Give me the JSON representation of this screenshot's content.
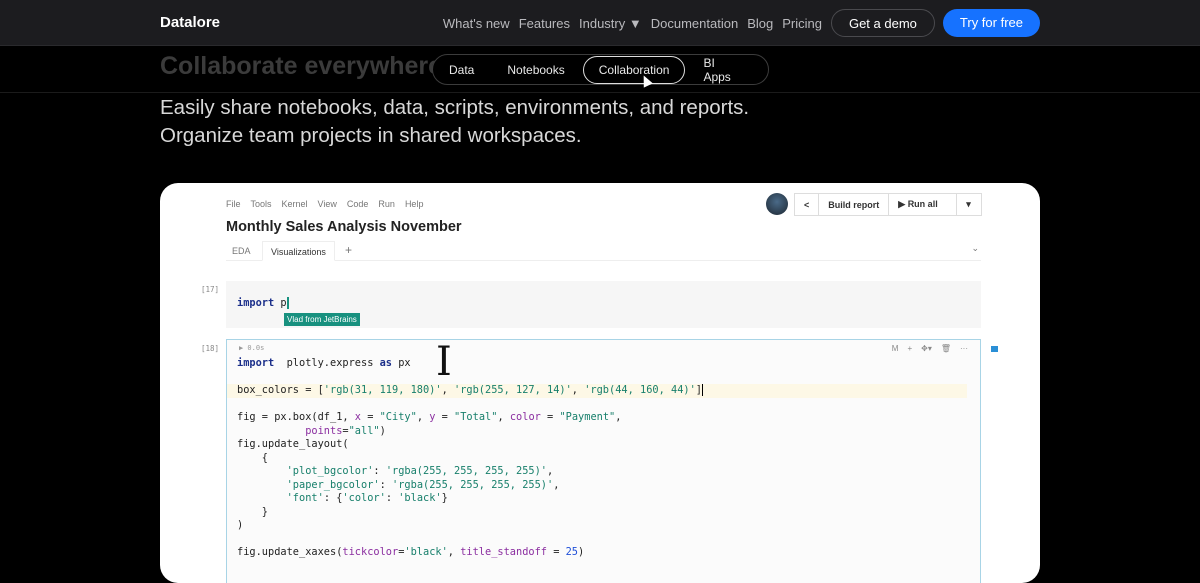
{
  "header": {
    "logo": "Datalore",
    "nav": [
      "What's new",
      "Features",
      "Industry ▼",
      "Documentation",
      "Blog",
      "Pricing"
    ],
    "demo": "Get a demo",
    "try": "Try for free"
  },
  "hero": {
    "heading": "Collaborate everywhere",
    "subnav": [
      "Data",
      "Notebooks",
      "Collaboration",
      "BI Apps"
    ],
    "active": "Collaboration",
    "subtitle": "Easily share notebooks, data, scripts, environments, and reports. Organize team projects in shared workspaces."
  },
  "notebook": {
    "menu": [
      "File",
      "Tools",
      "Kernel",
      "View",
      "Code",
      "Run",
      "Help"
    ],
    "title": "Monthly Sales Analysis November",
    "tabs": [
      "EDA",
      "Visualizations",
      "+"
    ],
    "chevron": "⌄",
    "toolbar": {
      "share": "share-icon",
      "build": "Build report",
      "run": "▶ Run all",
      "more": "▾"
    },
    "cell17": {
      "num": "[17]",
      "code_kw": "import",
      "code_rest": " p",
      "tag": "Vlad from JetBrains"
    },
    "cell18": {
      "num": "[18]",
      "run": "▶  0.0s",
      "icons": [
        "M",
        "+",
        "✥▾",
        "🗑",
        "···"
      ],
      "lines": [
        [
          [
            "kw",
            "import"
          ],
          [
            "",
            "  plotly.express "
          ],
          [
            "kw",
            "as"
          ],
          [
            "",
            " px"
          ]
        ],
        [],
        [
          [
            "",
            "box_colors = ["
          ],
          [
            "str",
            "'rgb(31, 119, 180)'"
          ],
          [
            "",
            ", "
          ],
          [
            "str",
            "'rgb(255, 127, 14)'"
          ],
          [
            "",
            ", "
          ],
          [
            "str",
            "'rgb(44, 160, 44)'"
          ],
          [
            "",
            "]"
          ]
        ],
        [],
        [
          [
            "",
            "fig = px.box(df_1, "
          ],
          [
            "par",
            "x"
          ],
          [
            "",
            " = "
          ],
          [
            "str",
            "\"City\""
          ],
          [
            "",
            ", "
          ],
          [
            "par",
            "y"
          ],
          [
            "",
            " = "
          ],
          [
            "str",
            "\"Total\""
          ],
          [
            "",
            ", "
          ],
          [
            "par",
            "color"
          ],
          [
            "",
            " = "
          ],
          [
            "str",
            "\"Payment\""
          ],
          [
            "",
            ","
          ]
        ],
        [
          [
            "",
            "           "
          ],
          [
            "par",
            "points"
          ],
          [
            "",
            "="
          ],
          [
            "str",
            "\"all\""
          ],
          [
            "",
            ")"
          ]
        ],
        [
          [
            "",
            "fig.update_layout("
          ]
        ],
        [
          [
            "",
            "    {"
          ]
        ],
        [
          [
            "",
            "        "
          ],
          [
            "str",
            "'plot_bgcolor'"
          ],
          [
            "",
            ": "
          ],
          [
            "str",
            "'rgba(255, 255, 255, 255)'"
          ],
          [
            "",
            ","
          ]
        ],
        [
          [
            "",
            "        "
          ],
          [
            "str",
            "'paper_bgcolor'"
          ],
          [
            "",
            ": "
          ],
          [
            "str",
            "'rgba(255, 255, 255, 255)'"
          ],
          [
            "",
            ","
          ]
        ],
        [
          [
            "",
            "        "
          ],
          [
            "str",
            "'font'"
          ],
          [
            "",
            ": {"
          ],
          [
            "str",
            "'color'"
          ],
          [
            "",
            ": "
          ],
          [
            "str",
            "'black'"
          ],
          [
            "",
            "}"
          ]
        ],
        [
          [
            "",
            "    }"
          ]
        ],
        [
          [
            "",
            ")"
          ]
        ],
        [],
        [
          [
            "",
            "fig.update_xaxes("
          ],
          [
            "par",
            "tickcolor"
          ],
          [
            "",
            "="
          ],
          [
            "str",
            "'black'"
          ],
          [
            "",
            ", "
          ],
          [
            "par",
            "title_standoff"
          ],
          [
            "",
            " = "
          ],
          [
            "num",
            "25"
          ],
          [
            "",
            ")"
          ]
        ]
      ]
    }
  }
}
